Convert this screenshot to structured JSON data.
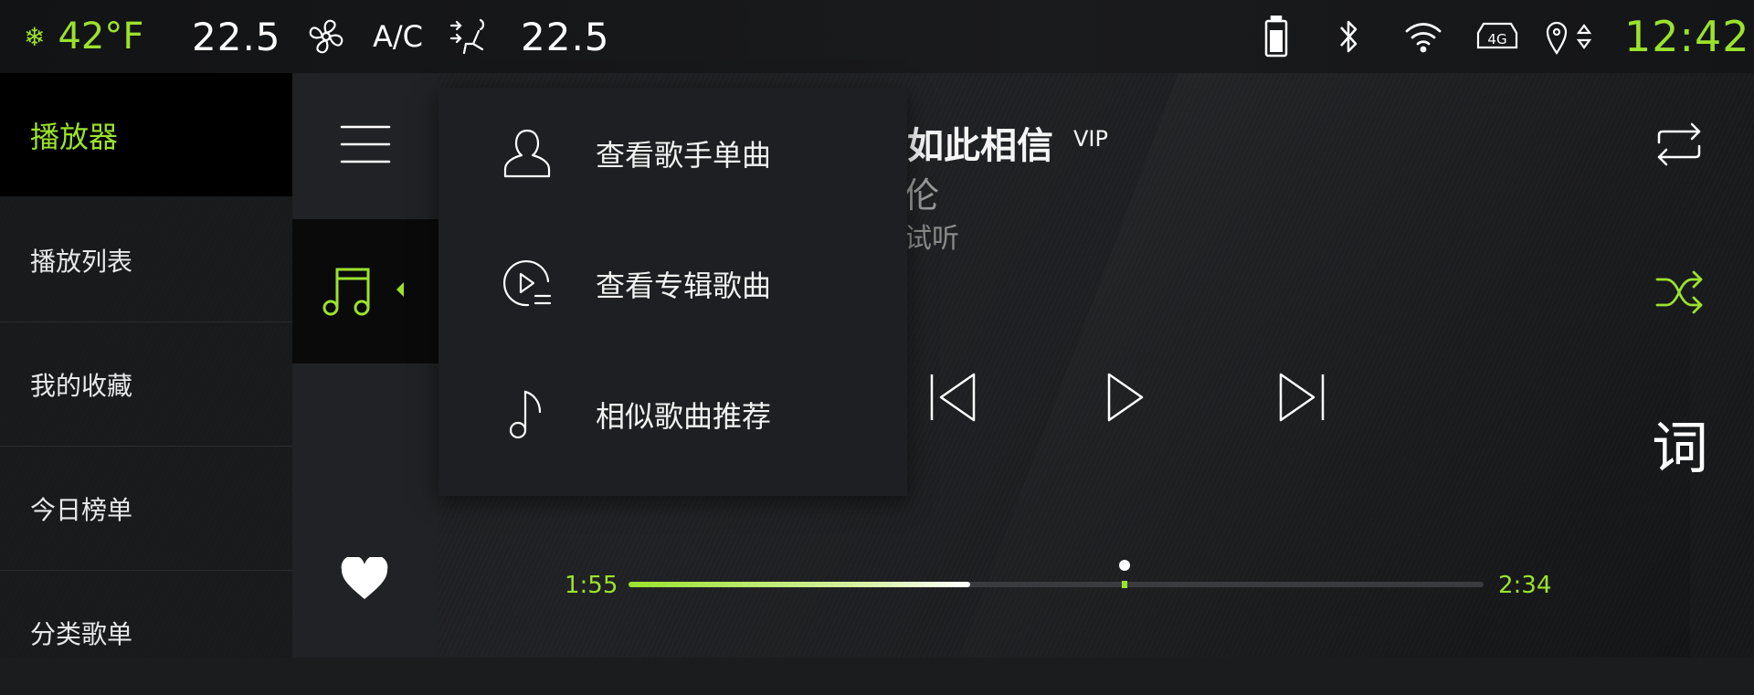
{
  "status": {
    "outside_temp": "42°F",
    "temp_left": "22.5",
    "ac_label": "A/C",
    "temp_right": "22.5",
    "network": "4G",
    "time": "12:42",
    "icons": [
      "snowflake-icon",
      "fan-icon",
      "seat-airflow-icon",
      "battery-icon",
      "bluetooth-icon",
      "wifi-icon",
      "network-4g-icon",
      "location-icon",
      "clock"
    ]
  },
  "sidebar": {
    "items": [
      {
        "label": "播放器",
        "active": true
      },
      {
        "label": "播放列表"
      },
      {
        "label": "我的收藏"
      },
      {
        "label": "今日榜单"
      },
      {
        "label": "分类歌单"
      }
    ]
  },
  "menu": {
    "items": [
      {
        "label": "查看歌手单曲",
        "icon": "person-icon"
      },
      {
        "label": "查看专辑歌曲",
        "icon": "album-play-icon"
      },
      {
        "label": "相似歌曲推荐",
        "icon": "music-note-icon"
      }
    ]
  },
  "song": {
    "title": "如此相信",
    "vip": "VIP",
    "artist": "伦",
    "trial": "试听"
  },
  "player": {
    "current_time": "1:55",
    "total_time": "2:34",
    "played_fraction": 0.4,
    "buffer_fraction": 0.58,
    "lyric_label": "词"
  },
  "colors": {
    "accent": "#9be22d"
  }
}
